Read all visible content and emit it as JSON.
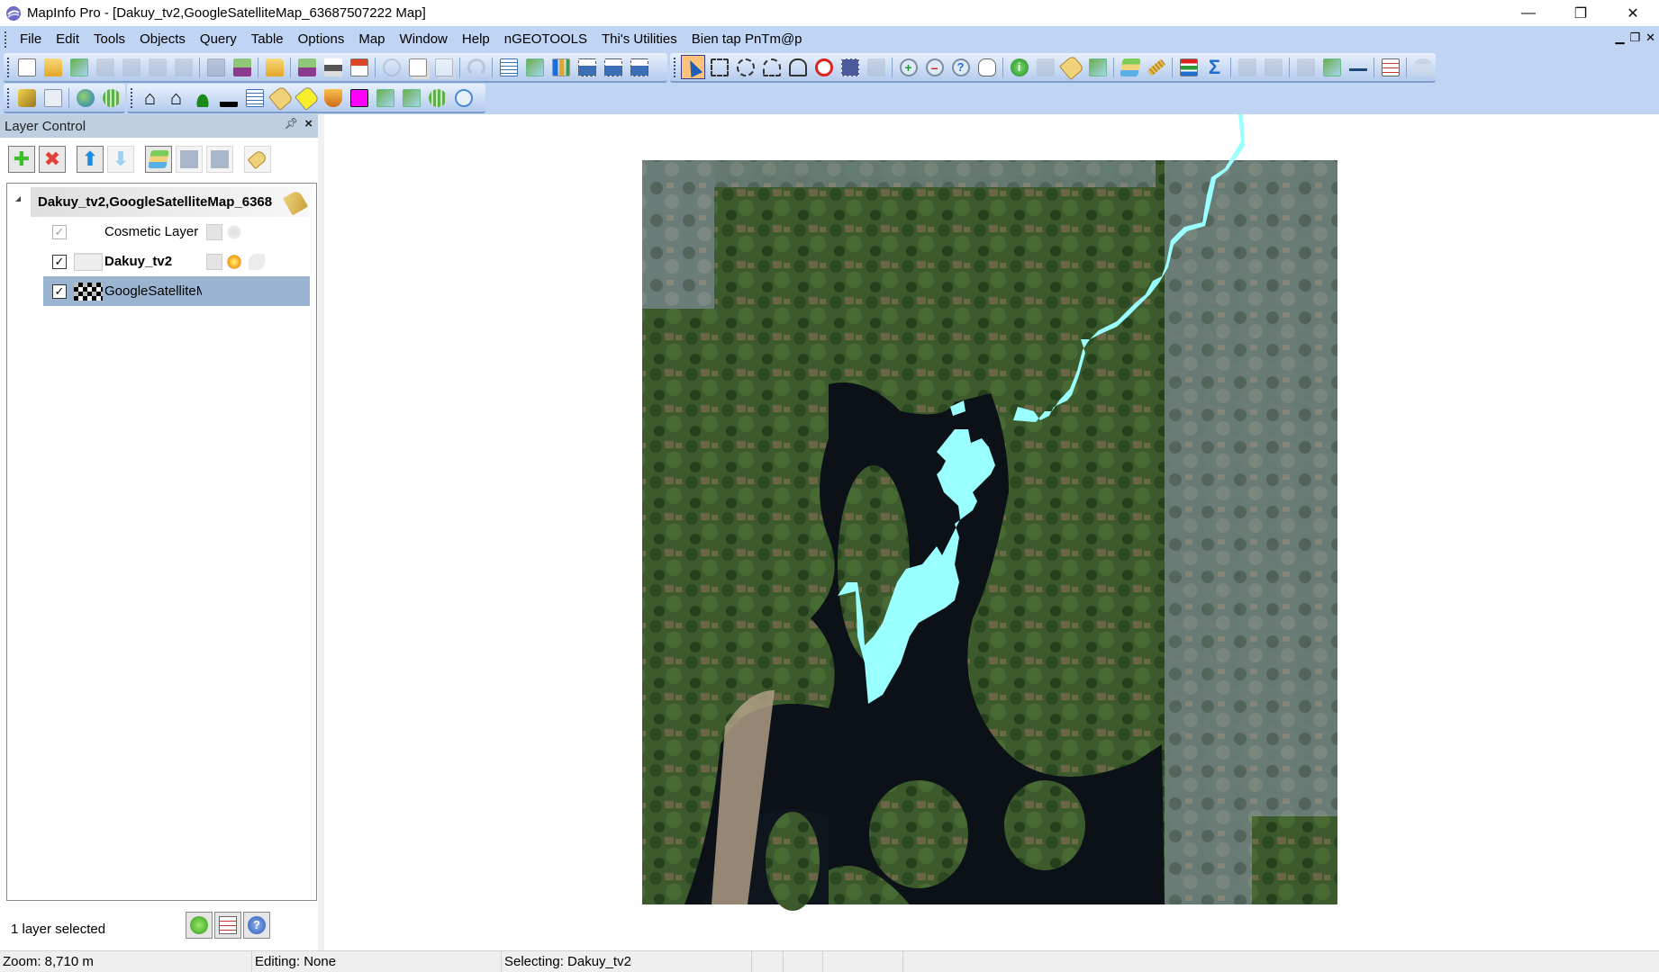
{
  "window": {
    "title": "MapInfo Pro - [Dakuy_tv2,GoogleSatelliteMap_63687507222 Map]",
    "controls": [
      "minimize",
      "restore",
      "close"
    ]
  },
  "menubar": {
    "items": [
      "File",
      "Edit",
      "Tools",
      "Objects",
      "Query",
      "Table",
      "Options",
      "Map",
      "Window",
      "Help",
      "nGEOTOOLS",
      "Thi's Utilities",
      "Bien tap PnTm@p"
    ]
  },
  "toolbars": {
    "standard": [
      "new-table",
      "open",
      "open-workspace",
      "disabled-1",
      "disabled-2",
      "disabled-3",
      "disabled-4",
      "save-table",
      "save-workspace",
      "open-dbms",
      "save-copy",
      "print",
      "export-pdf",
      "cut",
      "copy",
      "paste",
      "undo",
      "new-browser",
      "new-mapper",
      "new-grapher",
      "new-layout",
      "new-redistrict",
      "layout-window"
    ],
    "main": [
      "select",
      "marquee-select",
      "radius-select",
      "polygon-select",
      "boundary-select",
      "unselect-all",
      "invert-selection",
      "graph-select",
      "zoom-in",
      "zoom-out",
      "change-view",
      "grabber",
      "info",
      "hotlink",
      "label",
      "drag-map-window",
      "layer-control",
      "ruler",
      "legend",
      "statistics",
      "clip-region-on",
      "clip-region-off",
      "disabled-map",
      "set-clip",
      "scale-bar",
      "table-list",
      "add-feature"
    ],
    "tools": [
      "tool-manager",
      "tool-settings",
      "globe",
      "map-grid",
      "house",
      "houses",
      "flag-green",
      "anchor",
      "grid-table",
      "tag",
      "tag-yellow",
      "shield",
      "magenta-puzzle",
      "clip-map",
      "map-view",
      "globe-green",
      "search-rotate"
    ]
  },
  "layer_control": {
    "title": "Layer Control",
    "group": {
      "label": "Dakuy_tv2,GoogleSatelliteMap_6368",
      "expanded": true
    },
    "layers": [
      {
        "name": "Cosmetic Layer",
        "visible": true,
        "bold": false,
        "selected": false,
        "thumbnail": "none"
      },
      {
        "name": "Dakuy_tv2",
        "visible": true,
        "bold": true,
        "selected": false,
        "thumbnail": "region"
      },
      {
        "name": "GoogleSatelliteMaр",
        "visible": true,
        "bold": false,
        "selected": true,
        "thumbnail": "raster"
      }
    ],
    "status": "1 layer selected",
    "buttons": [
      "add-layer",
      "remove-layer",
      "move-up",
      "move-down",
      "layer-properties",
      "reproject",
      "hotlink",
      "label"
    ],
    "footer_buttons": [
      "apply",
      "options",
      "help"
    ]
  },
  "map": {
    "feature_color": "#99ffff",
    "water_color": "#0b1117"
  },
  "statusbar": {
    "zoom": "Zoom: 8,710 m",
    "editing": "Editing: None",
    "selecting": "Selecting: Dakuy_tv2"
  },
  "colors": {
    "chrome": "#c0d5f3",
    "selected_row": "#9ab4d2",
    "active_tool": "#ffc27a"
  }
}
